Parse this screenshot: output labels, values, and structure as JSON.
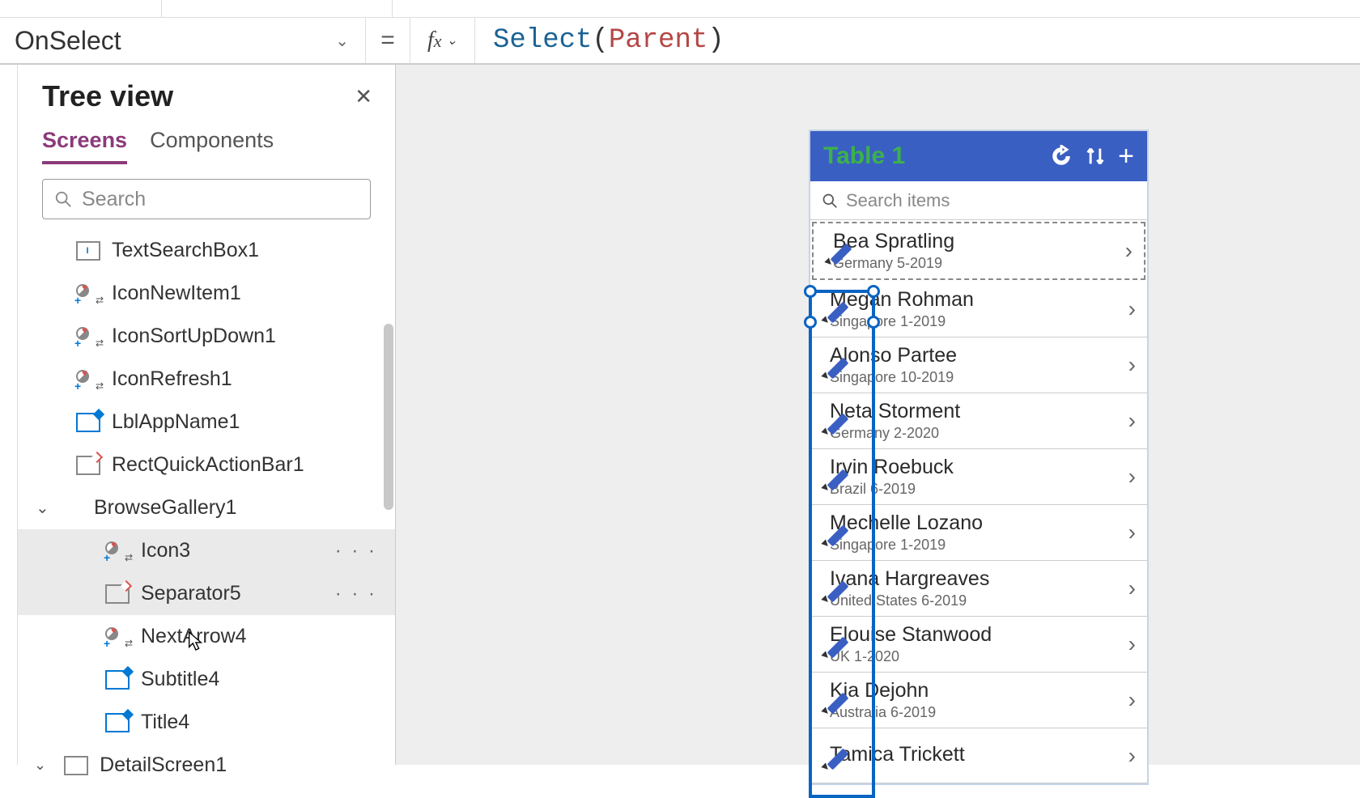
{
  "formula_bar": {
    "property": "OnSelect",
    "fn": "Select",
    "arg": "Parent"
  },
  "tree": {
    "title": "Tree view",
    "tabs": {
      "screens": "Screens",
      "components": "Components"
    },
    "search_placeholder": "Search",
    "items": {
      "textsearch": "TextSearchBox1",
      "iconnew": "IconNewItem1",
      "iconsort": "IconSortUpDown1",
      "iconrefresh": "IconRefresh1",
      "lblapp": "LblAppName1",
      "rectquick": "RectQuickActionBar1",
      "gallery": "BrowseGallery1",
      "icon3": "Icon3",
      "separator5": "Separator5",
      "nextarrow": "NextArrow4",
      "subtitle4": "Subtitle4",
      "title4": "Title4",
      "detailscreen": "DetailScreen1"
    }
  },
  "phone": {
    "title": "Table 1",
    "search_placeholder": "Search items",
    "rows": [
      {
        "name": "Bea Spratling",
        "sub": "Germany 5-2019"
      },
      {
        "name": "Megan Rohman",
        "sub": "Singapore 1-2019"
      },
      {
        "name": "Alonso Partee",
        "sub": "Singapore 10-2019"
      },
      {
        "name": "Neta Storment",
        "sub": "Germany 2-2020"
      },
      {
        "name": "Irvin Roebuck",
        "sub": "Brazil 6-2019"
      },
      {
        "name": "Mechelle Lozano",
        "sub": "Singapore 1-2019"
      },
      {
        "name": "Ivana Hargreaves",
        "sub": "United States 6-2019"
      },
      {
        "name": "Elouise Stanwood",
        "sub": "UK 1-2020"
      },
      {
        "name": "Kia Dejohn",
        "sub": "Australia 6-2019"
      },
      {
        "name": "Tamica Trickett",
        "sub": ""
      }
    ]
  }
}
